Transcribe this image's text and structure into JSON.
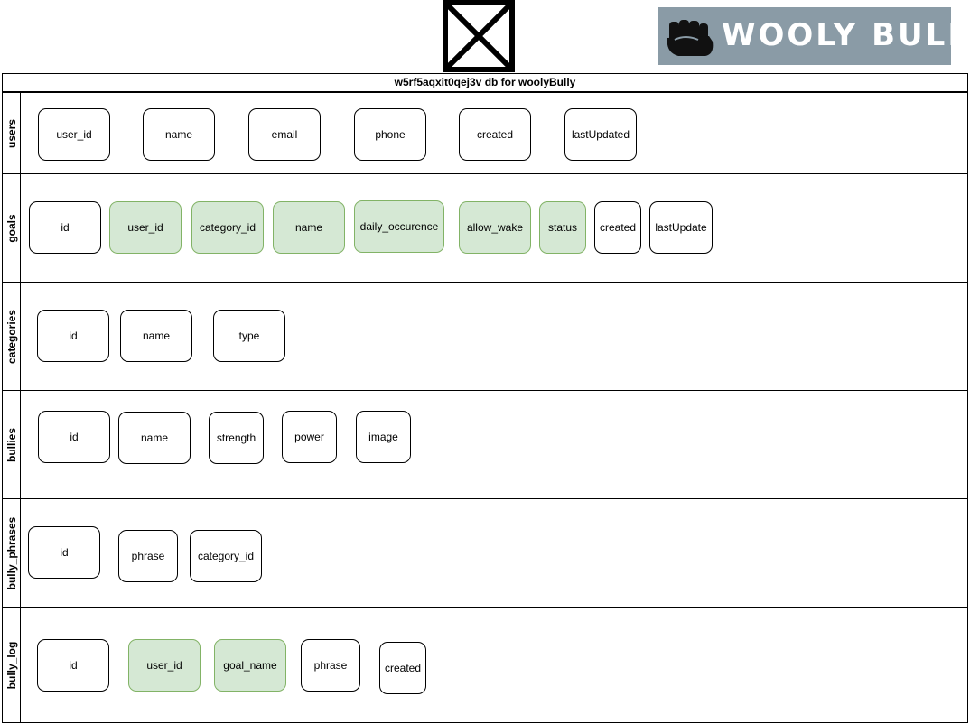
{
  "header": {
    "placeholder_image_icon": "broken-image-x-icon",
    "logo_text": "WOOLY BULLY",
    "logo_icon": "fist-icon",
    "logo_color": "#8a9ba6"
  },
  "diagram": {
    "title": "w5rf5aqxit0qej3v db for woolyBully",
    "fk_fill_color": "#d5e8d4",
    "fk_border_color": "#82b366",
    "tables": [
      {
        "name": "users",
        "fields": [
          {
            "label": "user_id",
            "fk": false
          },
          {
            "label": "name",
            "fk": false
          },
          {
            "label": "email",
            "fk": false
          },
          {
            "label": "phone",
            "fk": false
          },
          {
            "label": "created",
            "fk": false
          },
          {
            "label": "lastUpdated",
            "fk": false
          }
        ]
      },
      {
        "name": "goals",
        "fields": [
          {
            "label": "id",
            "fk": false
          },
          {
            "label": "user_id",
            "fk": true
          },
          {
            "label": "category_id",
            "fk": true
          },
          {
            "label": "name",
            "fk": true
          },
          {
            "label": "daily_occurence",
            "fk": true
          },
          {
            "label": "allow_wake",
            "fk": true
          },
          {
            "label": "status",
            "fk": true
          },
          {
            "label": "created",
            "fk": false
          },
          {
            "label": "lastUpdate",
            "fk": false
          }
        ]
      },
      {
        "name": "categories",
        "fields": [
          {
            "label": "id",
            "fk": false
          },
          {
            "label": "name",
            "fk": false
          },
          {
            "label": "type",
            "fk": false
          }
        ]
      },
      {
        "name": "bullies",
        "fields": [
          {
            "label": "id",
            "fk": false
          },
          {
            "label": "name",
            "fk": false
          },
          {
            "label": "strength",
            "fk": false
          },
          {
            "label": "power",
            "fk": false
          },
          {
            "label": "image",
            "fk": false
          }
        ]
      },
      {
        "name": "bully_phrases",
        "fields": [
          {
            "label": "id",
            "fk": false
          },
          {
            "label": "phrase",
            "fk": false
          },
          {
            "label": "category_id",
            "fk": false
          }
        ]
      },
      {
        "name": "bully_log",
        "fields": [
          {
            "label": "id",
            "fk": false
          },
          {
            "label": "user_id",
            "fk": true
          },
          {
            "label": "goal_name",
            "fk": true
          },
          {
            "label": "phrase",
            "fk": false
          },
          {
            "label": "created",
            "fk": false
          }
        ]
      }
    ]
  }
}
